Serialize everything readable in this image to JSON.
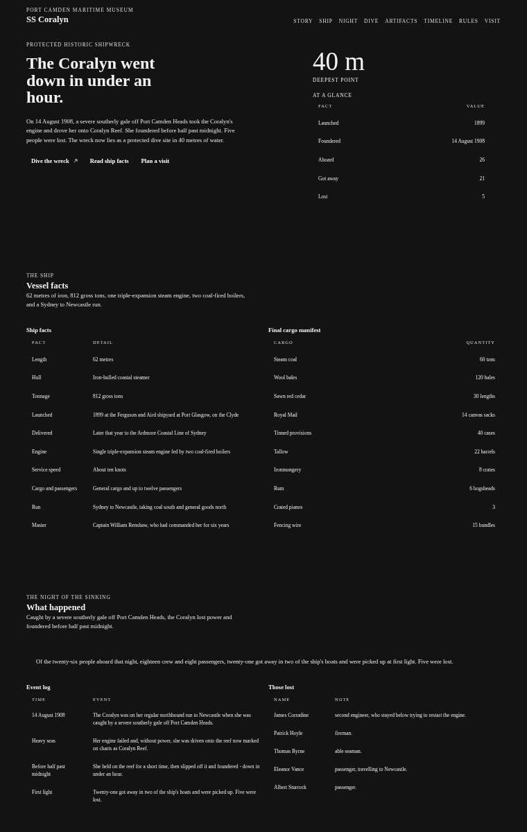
{
  "header": {
    "museum": "PORT CAMDEN MARITIME MUSEUM",
    "title": "SS Coralyn",
    "nav": [
      "STORY",
      "SHIP",
      "NIGHT",
      "DIVE",
      "ARTIFACTS",
      "TIMELINE",
      "RULES",
      "VISIT"
    ]
  },
  "hero": {
    "eyebrow": "PROTECTED HISTORIC SHIPWRECK",
    "heading": "The Coralyn went down in under an hour.",
    "intro": "On 14 August 1908, a severe southerly gale off Port Camden Heads took the Coralyn's engine and drove her onto Coralyn Reef. She foundered before half past midnight. Five people were lost. The wreck now lies as a protected dive site in 40 metres of water.",
    "actions": [
      {
        "label": "Dive the wreck",
        "kind": "external"
      },
      {
        "label": "Read ship facts",
        "kind": "plain"
      },
      {
        "label": "Plan a visit",
        "kind": "plain"
      }
    ],
    "stat": {
      "value": "40 m",
      "label": "DEEPEST POINT"
    },
    "glance": {
      "title": "AT A GLANCE",
      "kind": "key-value",
      "columns": [
        "FACT",
        "VALUE"
      ],
      "rows": [
        [
          "Launched",
          "1899"
        ],
        [
          "Foundered",
          "14 August 1908"
        ],
        [
          "Aboard",
          "26"
        ],
        [
          "Got away",
          "21"
        ],
        [
          "Lost",
          "5"
        ]
      ]
    }
  },
  "ship": {
    "eyebrow": "THE SHIP",
    "heading": "Vessel facts",
    "summary": "62 metres of iron, 812 gross tons, one triple-expansion steam engine, two coal-fired boilers, and a Sydney to Newcastle run.",
    "tables": [
      {
        "title": "Ship facts",
        "kind": "listing",
        "columns": [
          "FACT",
          "DETAIL"
        ],
        "rows": [
          [
            "Length",
            "62 metres"
          ],
          [
            "Hull",
            "Iron-hulled coastal steamer"
          ],
          [
            "Tonnage",
            "812 gross tons"
          ],
          [
            "Launched",
            "1899 at the Ferguson and Aird shipyard at Port Glasgow, on the Clyde"
          ],
          [
            "Delivered",
            "Later that year to the Ardmore Coastal Line of Sydney"
          ],
          [
            "Engine",
            "Single triple-expansion steam engine fed by two coal-fired boilers"
          ],
          [
            "Service speed",
            "About ten knots"
          ],
          [
            "Cargo and passengers",
            "General cargo and up to twelve passengers"
          ],
          [
            "Run",
            "Sydney to Newcastle, taking coal south and general goods north"
          ],
          [
            "Master",
            "Captain William Renshaw, who had commanded her for six years"
          ]
        ]
      },
      {
        "title": "Final cargo manifest",
        "kind": "key-value",
        "columns": [
          "CARGO",
          "QUANTITY"
        ],
        "rows": [
          [
            "Steam coal",
            "60 tons"
          ],
          [
            "Wool bales",
            "120 bales"
          ],
          [
            "Sawn red cedar",
            "30 lengths"
          ],
          [
            "Royal Mail",
            "14 canvas sacks"
          ],
          [
            "Tinned provisions",
            "40 cases"
          ],
          [
            "Tallow",
            "22 barrels"
          ],
          [
            "Ironmongery",
            "8 crates"
          ],
          [
            "Rum",
            "6 hogsheads"
          ],
          [
            "Crated pianos",
            "3"
          ],
          [
            "Fencing wire",
            "15 bundles"
          ]
        ]
      }
    ]
  },
  "night": {
    "eyebrow": "THE NIGHT OF THE SINKING",
    "heading": "What happened",
    "summary": "Caught by a severe southerly gale off Port Camden Heads, the Coralyn lost power and foundered before half past midnight.",
    "quote": "Of the twenty-six people aboard that night, eighteen crew and eight passengers, twenty-one got away in two of the ship's boats and were picked up at first light. Five were lost.",
    "tables": [
      {
        "title": "Event log",
        "kind": "listing",
        "columns": [
          "TIME",
          "EVENT"
        ],
        "rows": [
          [
            "14 August 1908",
            "The Coralyn was on her regular northbound run to Newcastle when she was caught by a severe southerly gale off Port Camden Heads."
          ],
          [
            "Heavy seas",
            "Her engine failed and, without power, she was driven onto the reef now marked on charts as Coralyn Reef."
          ],
          [
            "Before half past midnight",
            "She held on the reef for a short time, then slipped off it and foundered - down in under an hour."
          ],
          [
            "First light",
            "Twenty-one got away in two of the ship's boats and were picked up. Five were lost."
          ]
        ]
      },
      {
        "title": "Those lost",
        "kind": "listing",
        "columns": [
          "NAME",
          "NOTE"
        ],
        "rows": [
          [
            "James Corradine",
            "second engineer, who stayed below trying to restart the engine."
          ],
          [
            "Patrick Hoyle",
            "fireman."
          ],
          [
            "Thomas Byrne",
            "able seaman."
          ],
          [
            "Eleanor Vance",
            "passenger, travelling to Newcastle."
          ],
          [
            "Albert Sturrock",
            "passenger."
          ]
        ]
      }
    ]
  }
}
